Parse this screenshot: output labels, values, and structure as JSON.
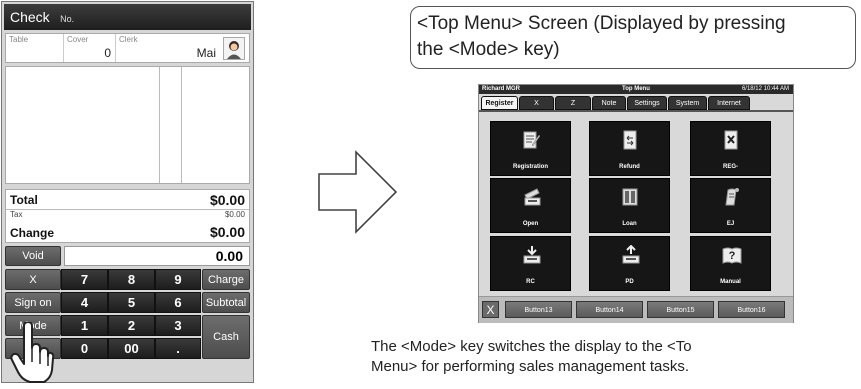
{
  "pos": {
    "title": "Check",
    "no_label": "No.",
    "table_label": "Table",
    "cover_label": "Cover",
    "cover_value": "0",
    "clerk_label": "Clerk",
    "clerk_name": "Mai",
    "total_label": "Total",
    "total_value": "$0.00",
    "tax_label": "Tax",
    "tax_value": "$0.00",
    "change_label": "Change",
    "change_value": "$0.00",
    "void_label": "Void",
    "amount_value": "0.00",
    "keys": {
      "x": "X",
      "sign_on": "Sign on",
      "mode": "Mode",
      "charge": "Charge",
      "subtotal": "Subtotal",
      "cash": "Cash",
      "n7": "7",
      "n8": "8",
      "n9": "9",
      "n4": "4",
      "n5": "5",
      "n6": "6",
      "n1": "1",
      "n2": "2",
      "n3": "3",
      "n0": "0",
      "n00": "00",
      "dot": "."
    }
  },
  "callout": {
    "line1": "<Top Menu> Screen (Displayed by pressing",
    "line2": "the <Mode> key)"
  },
  "top_menu": {
    "user": "Richard MGR",
    "title": "Top Menu",
    "datetime": "6/18/12 10:44 AM",
    "tabs": [
      "Register",
      "X",
      "Z",
      "Note",
      "Settings",
      "System",
      "Internet"
    ],
    "tiles": [
      "Registration",
      "Refund",
      "REG-",
      "Open",
      "Loan",
      "EJ",
      "RC",
      "PD",
      "Manual"
    ],
    "close_label": "X",
    "function_buttons": [
      "Button13",
      "Button14",
      "Button15",
      "Button16"
    ]
  },
  "description": {
    "line1": "The <Mode> key switches the display to the <To",
    "line2": "Menu> for performing sales management tasks."
  }
}
